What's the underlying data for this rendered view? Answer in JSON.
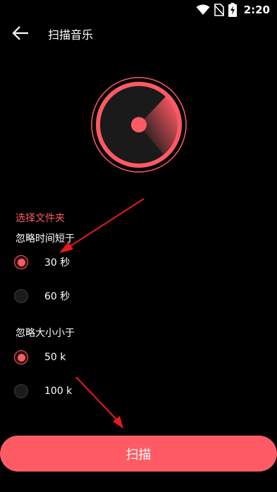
{
  "status_bar": {
    "time": "2:20",
    "icons": [
      "wifi-icon",
      "no-sim-icon",
      "battery-charging-icon"
    ]
  },
  "app_bar": {
    "back_icon": "arrow-left-icon",
    "title": "扫描音乐"
  },
  "radar_icon": "radar-icon",
  "folder_select_label": "选择文件夹",
  "duration_filter": {
    "label": "忽略时间短于",
    "options": [
      {
        "label": "30 秒",
        "checked": true
      },
      {
        "label": "60 秒",
        "checked": false
      }
    ]
  },
  "size_filter": {
    "label": "忽略大小小于",
    "options": [
      {
        "label": "50 k",
        "checked": true
      },
      {
        "label": "100 k",
        "checked": false
      }
    ]
  },
  "scan_button_label": "扫描",
  "colors": {
    "accent": "#ff5a63",
    "button": "#ff5b65",
    "arrow": "#e8181f",
    "background": "#000000"
  }
}
